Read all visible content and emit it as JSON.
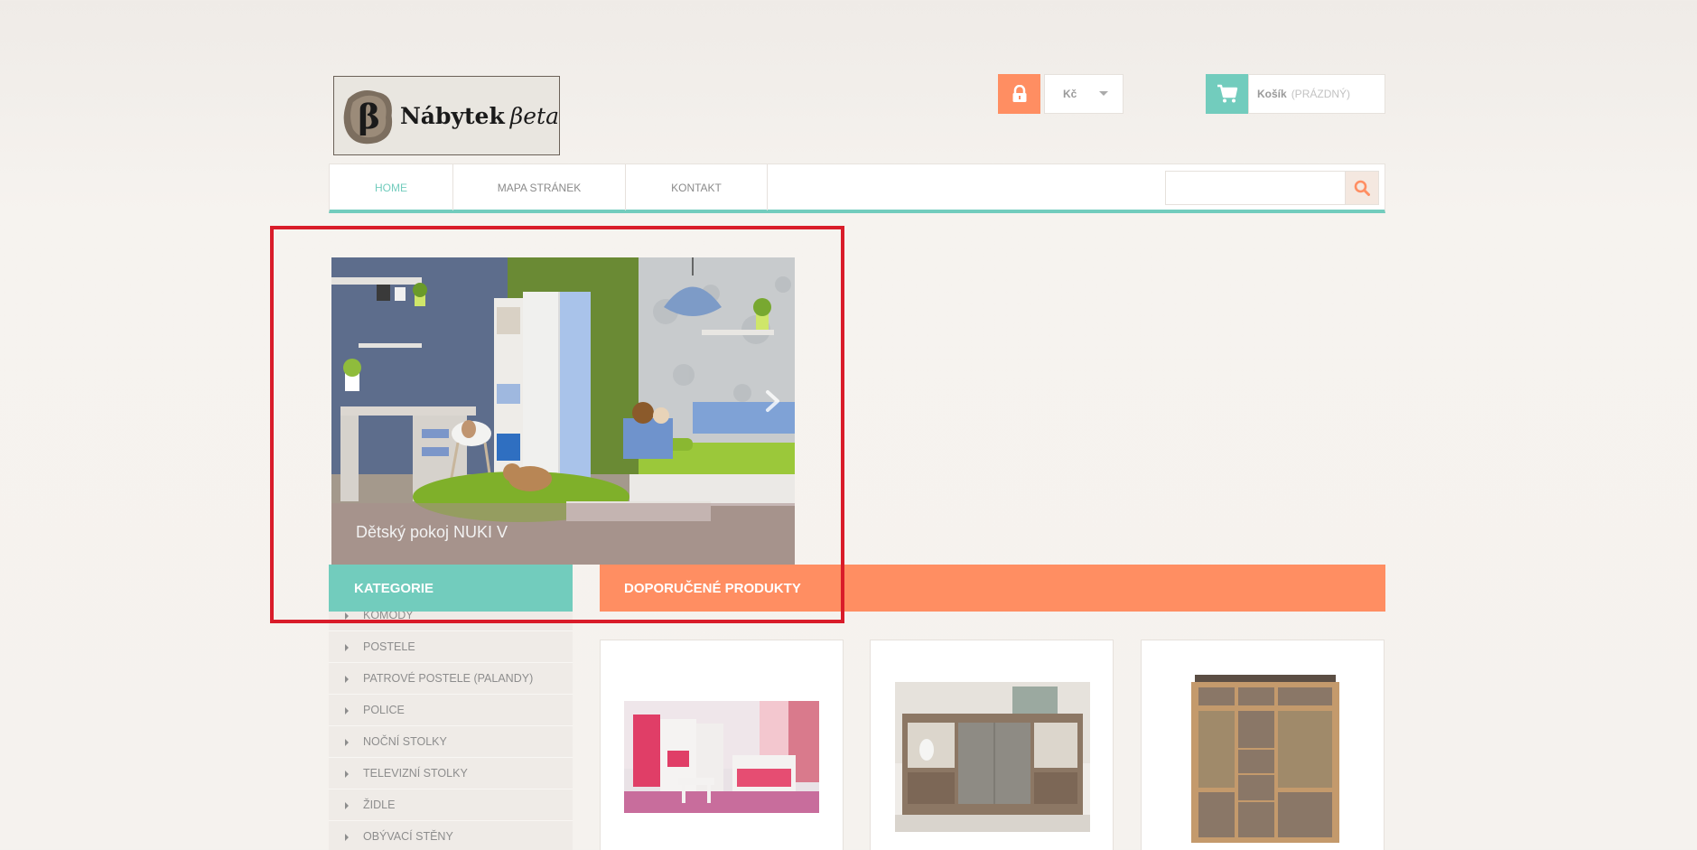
{
  "brand": {
    "logo_text": "Nábytek",
    "logo_script": "βeta"
  },
  "header": {
    "currency": "Kč",
    "cart_label": "Košík",
    "cart_status": "(PRÁZDNÝ)"
  },
  "nav": {
    "items": [
      {
        "label": "HOME",
        "active": true
      },
      {
        "label": "MAPA STRÁNEK",
        "active": false
      },
      {
        "label": "KONTAKT",
        "active": false
      }
    ],
    "search": {
      "placeholder": "",
      "value": ""
    }
  },
  "slider": {
    "caption": "Dětský pokoj NUKI V"
  },
  "categories": {
    "title": "KATEGORIE",
    "items": [
      "KOMODY",
      "POSTELE",
      "PATROVÉ POSTELE (PALANDY)",
      "POLICE",
      "NOČNÍ STOLKY",
      "TELEVIZNÍ STOLKY",
      "ŽIDLE",
      "OBÝVACÍ STĚNY"
    ]
  },
  "featured": {
    "title": "DOPORUČENÉ PRODUKTY",
    "products": [
      {
        "image": "pink-kids-room"
      },
      {
        "image": "sideboard-cabinet"
      },
      {
        "image": "display-cabinet"
      }
    ]
  },
  "colors": {
    "teal": "#72ccbd",
    "orange": "#ff8e62",
    "highlight": "#d91c2a"
  },
  "icons": [
    "lock-icon",
    "cart-icon",
    "search-icon",
    "chevron-right-icon",
    "chevron-down-icon"
  ]
}
